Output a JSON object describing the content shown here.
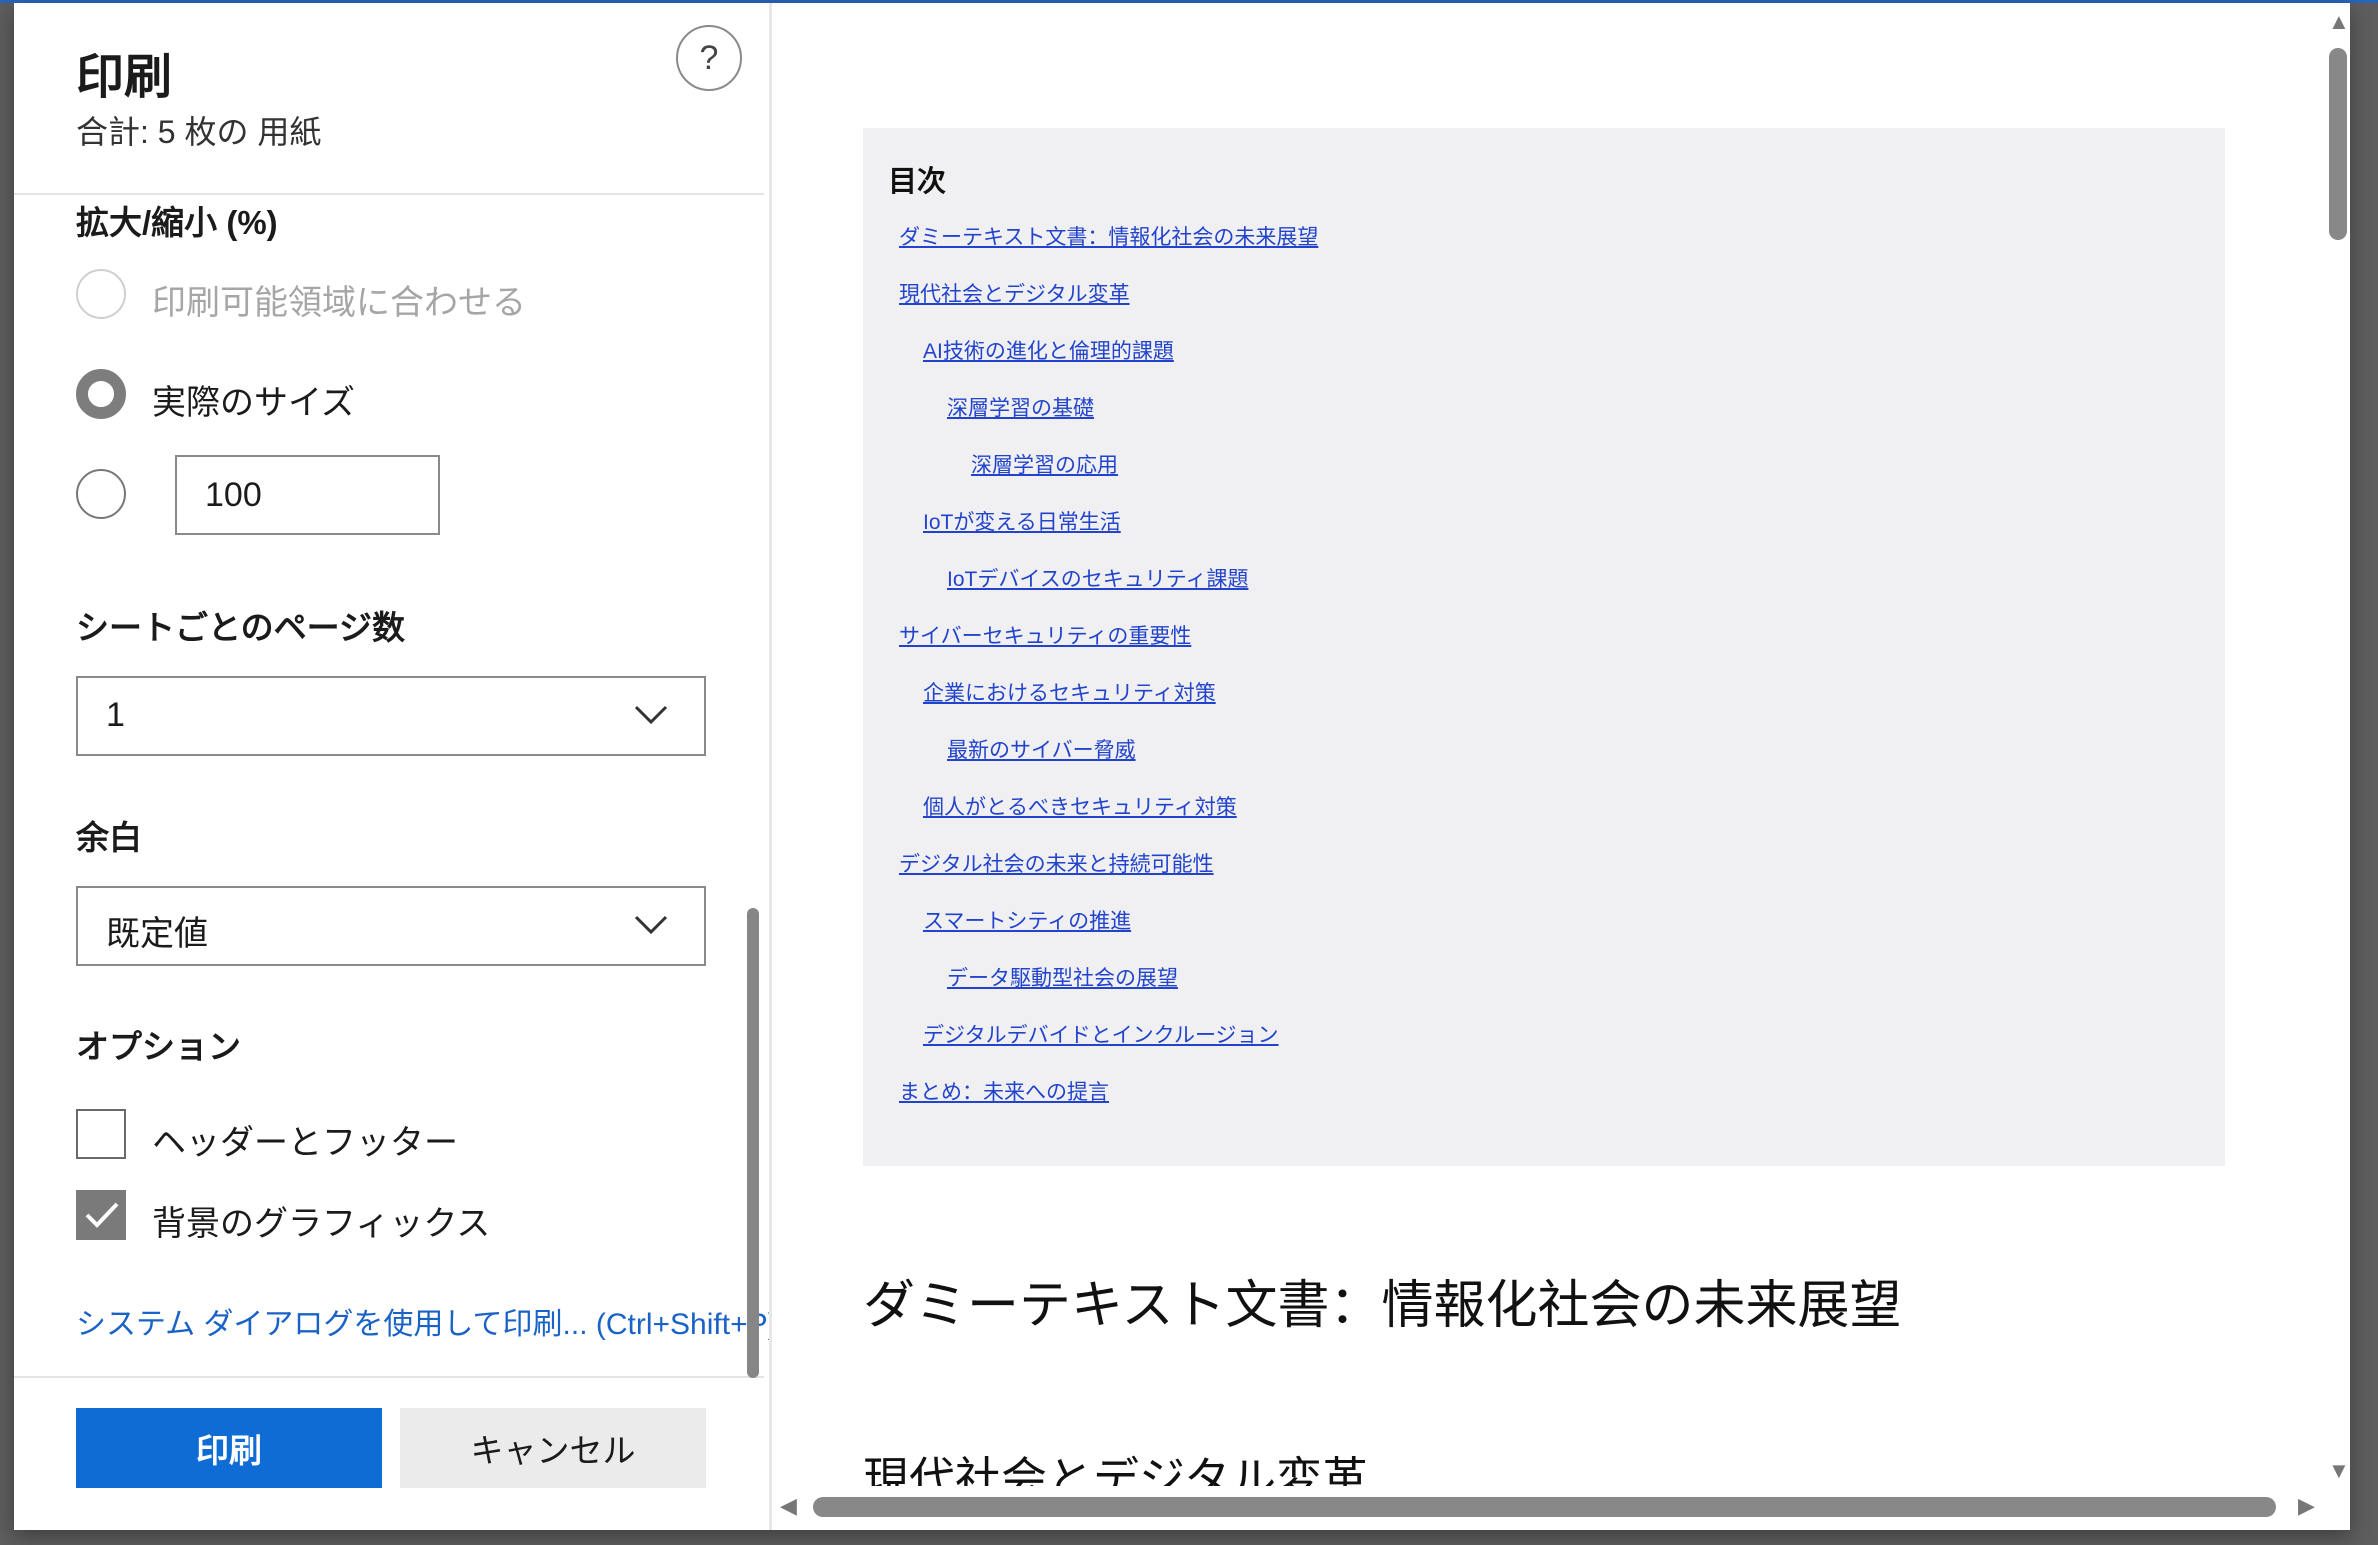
{
  "panel": {
    "title": "印刷",
    "subtitle": "合計: 5 枚の 用紙",
    "help_label": "?",
    "scale": {
      "title": "拡大/縮小 (%)",
      "options": [
        {
          "label": "印刷可能領域に合わせる",
          "state": "disabled"
        },
        {
          "label": "実際のサイズ",
          "state": "checked"
        },
        {
          "label": "",
          "state": "unchecked"
        }
      ],
      "custom_value": "100"
    },
    "pages_per_sheet": {
      "title": "シートごとのページ数",
      "value": "1"
    },
    "margins": {
      "title": "余白",
      "value": "既定値"
    },
    "options": {
      "title": "オプション",
      "items": [
        {
          "label": "ヘッダーとフッター",
          "checked": false
        },
        {
          "label": "背景のグラフィックス",
          "checked": true
        }
      ]
    },
    "system_dialog_link": "システム ダイアログを使用して印刷... (Ctrl+Shift+P)",
    "print_button": "印刷",
    "cancel_button": "キャンセル"
  },
  "preview": {
    "toc": {
      "title": "目次",
      "items": [
        {
          "text": "ダミーテキスト文書：情報化社会の未来展望",
          "level": 0
        },
        {
          "text": "現代社会とデジタル変革",
          "level": 0
        },
        {
          "text": "AI技術の進化と倫理的課題",
          "level": 1
        },
        {
          "text": "深層学習の基礎",
          "level": 2
        },
        {
          "text": "深層学習の応用",
          "level": 3
        },
        {
          "text": "IoTが変える日常生活",
          "level": 1
        },
        {
          "text": "IoTデバイスのセキュリティ課題",
          "level": 2
        },
        {
          "text": "サイバーセキュリティの重要性",
          "level": 0
        },
        {
          "text": "企業におけるセキュリティ対策",
          "level": 1
        },
        {
          "text": "最新のサイバー脅威",
          "level": 2
        },
        {
          "text": "個人がとるべきセキュリティ対策",
          "level": 1
        },
        {
          "text": "デジタル社会の未来と持続可能性",
          "level": 0
        },
        {
          "text": "スマートシティの推進",
          "level": 1
        },
        {
          "text": "データ駆動型社会の展望",
          "level": 2
        },
        {
          "text": "デジタルデバイドとインクルージョン",
          "level": 1
        },
        {
          "text": "まとめ：未来への提言",
          "level": 0
        }
      ]
    },
    "heading1": "ダミーテキスト文書：情報化社会の未来展望",
    "heading2": "現代社会とデジタル変革"
  },
  "colors": {
    "accent": "#0f6cd5",
    "link": "#1a63c6",
    "toc_link": "#2244cc",
    "toc_bg": "#f0f0f2"
  },
  "icons": {
    "help": "help-icon",
    "select": "chevron-down-icon",
    "check": "check-icon"
  }
}
